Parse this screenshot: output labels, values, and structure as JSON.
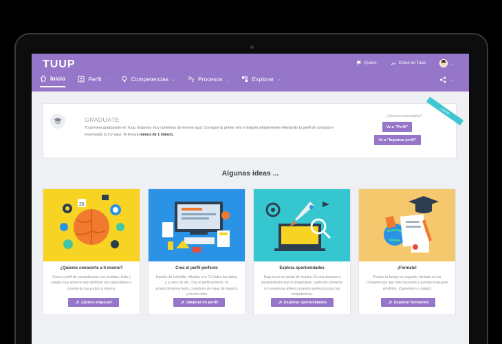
{
  "app": {
    "logo": "TUUP"
  },
  "header": {
    "top_links": [
      {
        "label": "Quiero",
        "icon": "flag-icon"
      },
      {
        "label": "Crece en Tuup",
        "icon": "trend-icon"
      }
    ],
    "nav": [
      {
        "label": "Inicio",
        "icon": "home-icon",
        "active": true
      },
      {
        "label": "Perfil",
        "icon": "profile-icon",
        "dropdown": true
      },
      {
        "label": "Competencias",
        "icon": "bulb-icon",
        "dropdown": true
      },
      {
        "label": "Procesos",
        "icon": "process-icon",
        "dropdown": true
      },
      {
        "label": "Explorar",
        "icon": "explore-icon",
        "dropdown": true
      }
    ]
  },
  "graduate": {
    "title": "GRADUATE",
    "text": "Tu primera graduación en Tuup. Estamos muy contentos de tenerte aquí. Consigue tu primer reto e insignia simplemente rellenando tu perfil de contacto e importando tu CV aquí. Te llevará",
    "text_bold": "menos de 1 minuto.",
    "question": "¿Quieres conseguirla?",
    "btn_profile": "Ve a \"Perfil\"",
    "btn_import": "Ve a \"Importar perfil\"",
    "ribbon": "JUNIOR"
  },
  "ideas_title": "Algunas ideas ...",
  "cards": [
    {
      "title": "¿Quieres conocerte a ti mismo?",
      "text": "Crea tu perfil de competencias con pruebas, tests y juegos muy amenos que definirán tus capacidades y conocerás tus puntos a mejorar",
      "button": "¡Quiero empezar!"
    },
    {
      "title": "Crea el perfil perfecto",
      "text": "Importa de LinkedIn, Infojobs o tu CV todos tus datos, y a partir de ahí, crea el perfil perfecto. Te proporcionamos tests, creadores de hojas de impacto y mucho más",
      "button": "¡Mejorar mi perfil!"
    },
    {
      "title": "Explora oportunidades",
      "text": "Tuup no es un portal de empleo. Es una semana a oportunidades que ni imaginabas, pudiendo contactar con empresas afines y puestos perfectos para tus competencias.",
      "button": "Explorar oportunidades"
    },
    {
      "title": "¡Fórmate!",
      "text": "Porque tu tiempo es sagrado, fórmate en las competencias que más necesites y puedas empujarte al infinito. ¡Queremos ir contigo!",
      "button": "Explorar formación"
    }
  ],
  "colors": {
    "brand": "#9576c9",
    "card1_bg": "#f7d323",
    "card2_bg": "#2a93e6",
    "card3_bg": "#36c6cf",
    "card4_bg": "#f6c86e"
  }
}
